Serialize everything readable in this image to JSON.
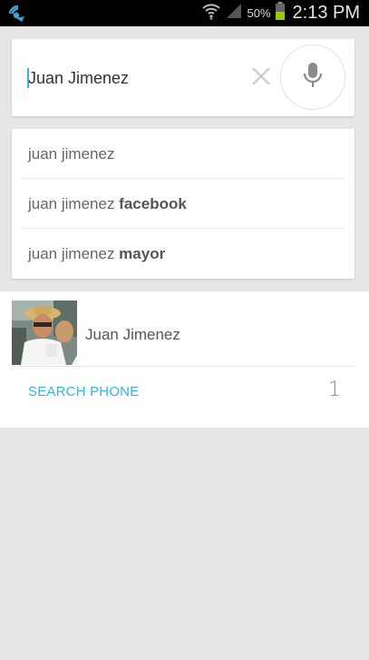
{
  "status_bar": {
    "battery_percent": "50%",
    "time": "2:13 PM"
  },
  "search": {
    "query": "Juan Jimenez"
  },
  "suggestions": [
    {
      "prefix": "juan jimenez",
      "suffix": ""
    },
    {
      "prefix": "juan jimenez ",
      "suffix": "facebook"
    },
    {
      "prefix": "juan jimenez ",
      "suffix": "mayor"
    }
  ],
  "contact": {
    "name": "Juan Jimenez"
  },
  "search_phone": {
    "label": "SEARCH PHONE",
    "count": "1"
  },
  "colors": {
    "accent": "#33b5e5",
    "background": "#e6e6e6",
    "battery": "#99cc00"
  },
  "icons": [
    "app-notification-icon",
    "wifi-icon",
    "signal-icon",
    "battery-icon",
    "clear-icon",
    "mic-icon"
  ]
}
